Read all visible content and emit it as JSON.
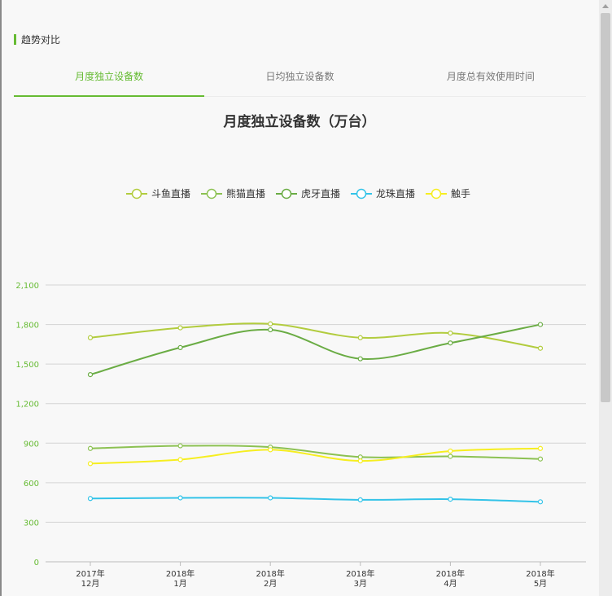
{
  "section": {
    "title": "趋势对比"
  },
  "tabs": [
    {
      "label": "月度独立设备数",
      "active": true
    },
    {
      "label": "日均独立设备数",
      "active": false
    },
    {
      "label": "月度总有效使用时间",
      "active": false
    }
  ],
  "colors": {
    "accent": "#66bb33"
  },
  "chart_data": {
    "type": "line",
    "title": "月度独立设备数（万台）",
    "categories": [
      [
        "2017年",
        "12月"
      ],
      [
        "2018年",
        "1月"
      ],
      [
        "2018年",
        "2月"
      ],
      [
        "2018年",
        "3月"
      ],
      [
        "2018年",
        "4月"
      ],
      [
        "2018年",
        "5月"
      ]
    ],
    "ylim": [
      0,
      2100
    ],
    "yticks": [
      0,
      300,
      600,
      900,
      1200,
      1500,
      1800,
      2100
    ],
    "ytick_labels": [
      "0",
      "300",
      "600",
      "900",
      "1,200",
      "1,500",
      "1,800",
      "2,100"
    ],
    "grid": true,
    "legend_position": "top-center",
    "series": [
      {
        "name": "斗鱼直播",
        "color": "#b2cc3e",
        "values": [
          1700,
          1775,
          1805,
          1700,
          1735,
          1620
        ]
      },
      {
        "name": "熊猫直播",
        "color": "#8cc152",
        "values": [
          860,
          880,
          870,
          795,
          800,
          780
        ]
      },
      {
        "name": "虎牙直播",
        "color": "#6aac44",
        "values": [
          1420,
          1625,
          1760,
          1540,
          1660,
          1800
        ]
      },
      {
        "name": "龙珠直播",
        "color": "#33c3e8",
        "values": [
          480,
          485,
          485,
          470,
          475,
          455
        ]
      },
      {
        "name": "触手",
        "color": "#f6ee20",
        "values": [
          745,
          775,
          850,
          765,
          840,
          860
        ]
      }
    ]
  }
}
